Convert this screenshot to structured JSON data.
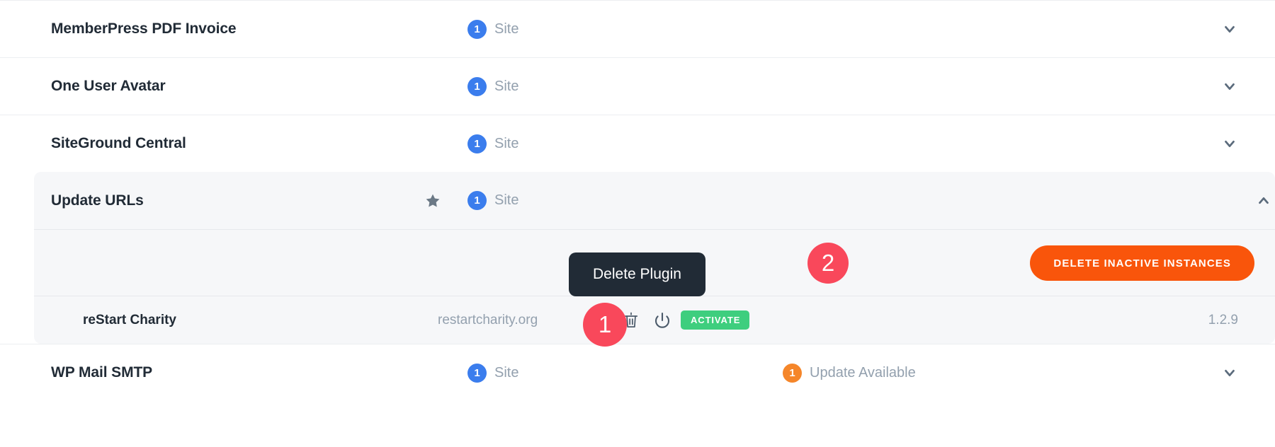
{
  "plugins": [
    {
      "name": "MemberPress PDF Invoice",
      "site_count": "1",
      "site_label": "Site",
      "favorite": false,
      "expanded": false,
      "chevron": "chevron-down-icon"
    },
    {
      "name": "One User Avatar",
      "site_count": "1",
      "site_label": "Site",
      "favorite": false,
      "expanded": false,
      "chevron": "chevron-down-icon"
    },
    {
      "name": "SiteGround Central",
      "site_count": "1",
      "site_label": "Site",
      "favorite": false,
      "expanded": false,
      "chevron": "chevron-down-icon"
    },
    {
      "name": "Update URLs",
      "site_count": "1",
      "site_label": "Site",
      "favorite": true,
      "expanded": true,
      "chevron": "chevron-up-icon"
    },
    {
      "name": "WP Mail SMTP",
      "site_count": "1",
      "site_label": "Site",
      "update_count": "1",
      "update_label": "Update Available",
      "favorite": false,
      "expanded": false,
      "chevron": "chevron-down-icon"
    }
  ],
  "expanded_panel": {
    "delete_inactive_label": "DELETE INACTIVE INSTANCES",
    "site": {
      "name": "reStart Charity",
      "domain": "restartcharity.org",
      "delete_icon": "trash-icon",
      "power_icon": "power-icon",
      "activate_label": "ACTIVATE",
      "version": "1.2.9"
    }
  },
  "tooltip": {
    "text": "Delete Plugin"
  },
  "annotations": {
    "step_one": "1",
    "step_two": "2"
  },
  "colors": {
    "badge_blue": "#3b7ded",
    "badge_orange": "#f5862a",
    "activate_green": "#3ece7e",
    "delete_orange": "#f9550b",
    "annotation_red": "#f9485b",
    "tooltip_dark": "#212b36",
    "card_bg": "#f6f7f9"
  }
}
